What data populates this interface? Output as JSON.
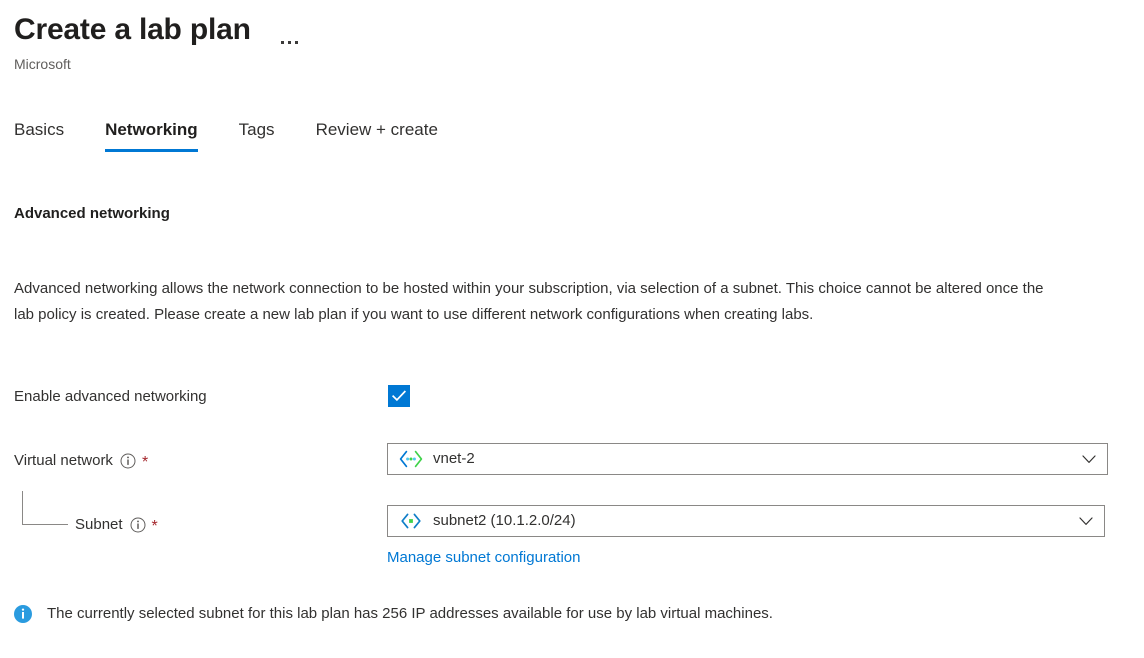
{
  "header": {
    "title": "Create a lab plan",
    "subtitle": "Microsoft",
    "more_menu_label": "More"
  },
  "tabs": [
    {
      "label": "Basics",
      "active": false
    },
    {
      "label": "Networking",
      "active": true
    },
    {
      "label": "Tags",
      "active": false
    },
    {
      "label": "Review + create",
      "active": false
    }
  ],
  "section": {
    "heading": "Advanced networking",
    "description": "Advanced networking allows the network connection to be hosted within your subscription, via selection of a subnet. This choice cannot be altered once the lab policy is created. Please create a new lab plan if you want to use different network configurations when creating labs."
  },
  "form": {
    "enable_advanced_networking": {
      "label": "Enable advanced networking",
      "checked": true
    },
    "virtual_network": {
      "label": "Virtual network",
      "required_marker": "*",
      "value": "vnet-2",
      "icon": "virtual-network-icon",
      "chevron": "chevron-down-icon"
    },
    "subnet": {
      "label": "Subnet",
      "required_marker": "*",
      "value": "subnet2 (10.1.2.0/24)",
      "icon": "subnet-icon",
      "chevron": "chevron-down-icon"
    },
    "manage_subnet_link": "Manage subnet configuration"
  },
  "info_message": {
    "icon": "info-circle-icon",
    "text": "The currently selected subnet for this lab plan has 256 IP addresses available for use by lab virtual machines."
  },
  "colors": {
    "accent": "#0078d4",
    "link": "#0078d4",
    "required": "#a4262c",
    "text": "#323130",
    "subtle_text": "#605e5c",
    "border": "#8a8886"
  }
}
